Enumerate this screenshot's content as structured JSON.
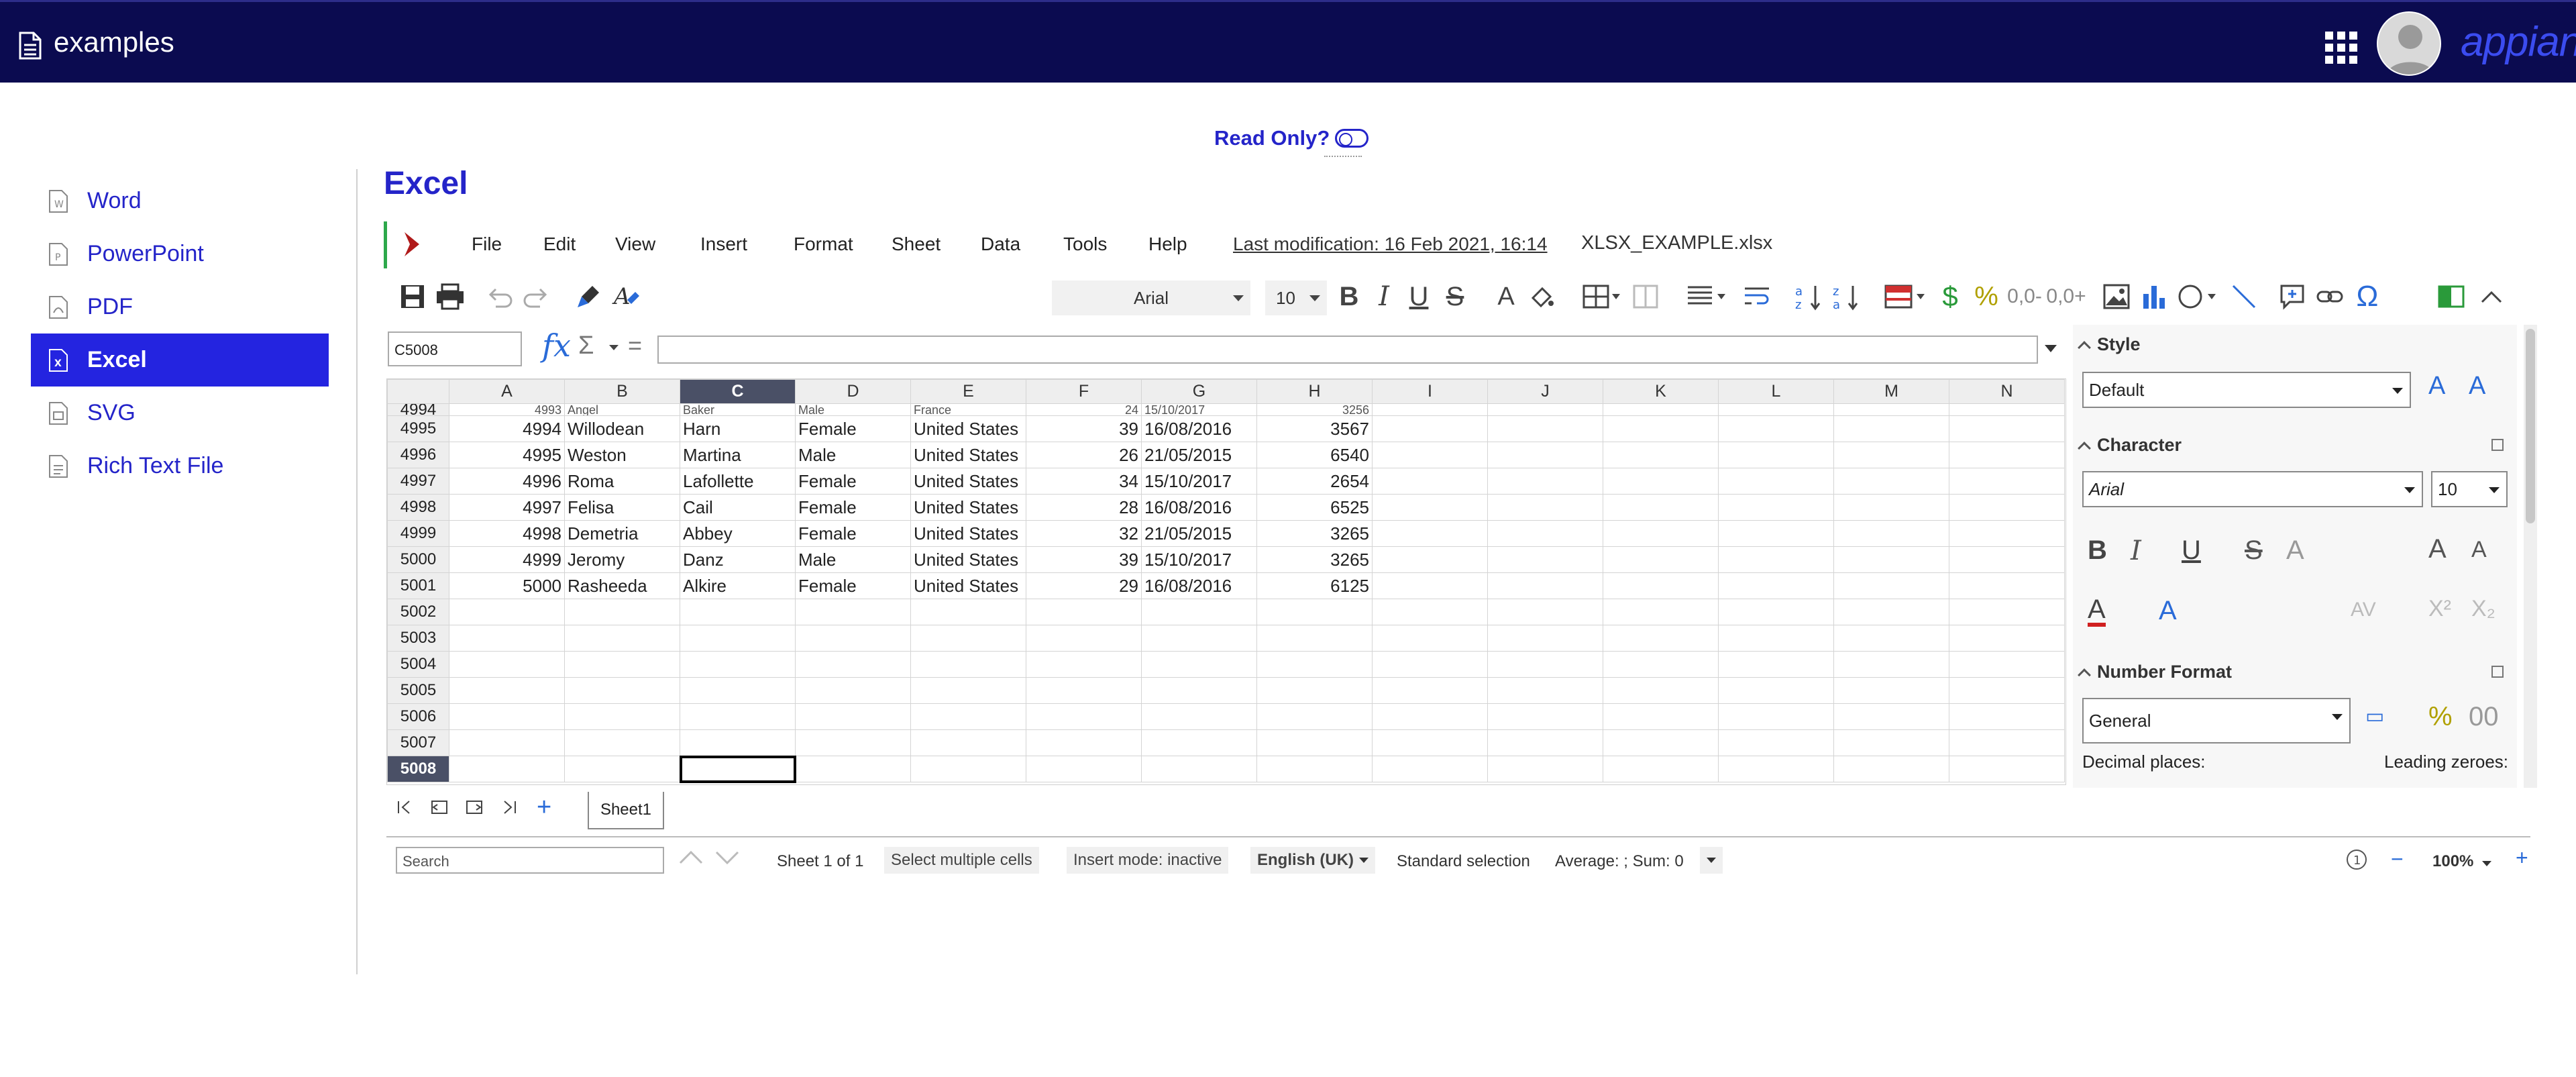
{
  "header": {
    "app_title": "examples",
    "logo_text": "appian"
  },
  "sidebar": {
    "items": [
      {
        "label": "Word",
        "icon": "word-file-icon"
      },
      {
        "label": "PowerPoint",
        "icon": "powerpoint-file-icon"
      },
      {
        "label": "PDF",
        "icon": "pdf-file-icon"
      },
      {
        "label": "Excel",
        "icon": "excel-file-icon",
        "active": true
      },
      {
        "label": "SVG",
        "icon": "svg-file-icon"
      },
      {
        "label": "Rich Text File",
        "icon": "rich-text-file-icon"
      }
    ]
  },
  "readonly": {
    "label": "Read Only?",
    "toggle_on": false
  },
  "page_title": "Excel",
  "menu": {
    "items": [
      "File",
      "Edit",
      "View",
      "Insert",
      "Format",
      "Sheet",
      "Data",
      "Tools",
      "Help"
    ],
    "last_modification": "Last modification:  16 Feb 2021, 16:14",
    "filename": "XLSX_EXAMPLE.xlsx"
  },
  "toolbar": {
    "font_name": "Arial",
    "font_size": "10"
  },
  "formula": {
    "cell_ref": "C5008",
    "fx_label": "fx",
    "sigma_label": "Σ",
    "equals_label": "=",
    "value": ""
  },
  "grid": {
    "columns": [
      "A",
      "B",
      "C",
      "D",
      "E",
      "F",
      "G",
      "H",
      "I",
      "J",
      "K",
      "L",
      "M",
      "N"
    ],
    "selected_column": "C",
    "partial_row": {
      "row": "4994",
      "cells": [
        "4993",
        "Angel",
        "Baker",
        "Male",
        "France",
        "24",
        "15/10/2017",
        "3256"
      ]
    },
    "rows": [
      {
        "row": "4995",
        "cells": [
          "4994",
          "Willodean",
          "Harn",
          "Female",
          "United States",
          "39",
          "16/08/2016",
          "3567"
        ]
      },
      {
        "row": "4996",
        "cells": [
          "4995",
          "Weston",
          "Martina",
          "Male",
          "United States",
          "26",
          "21/05/2015",
          "6540"
        ]
      },
      {
        "row": "4997",
        "cells": [
          "4996",
          "Roma",
          "Lafollette",
          "Female",
          "United States",
          "34",
          "15/10/2017",
          "2654"
        ]
      },
      {
        "row": "4998",
        "cells": [
          "4997",
          "Felisa",
          "Cail",
          "Female",
          "United States",
          "28",
          "16/08/2016",
          "6525"
        ]
      },
      {
        "row": "4999",
        "cells": [
          "4998",
          "Demetria",
          "Abbey",
          "Female",
          "United States",
          "32",
          "21/05/2015",
          "3265"
        ]
      },
      {
        "row": "5000",
        "cells": [
          "4999",
          "Jeromy",
          "Danz",
          "Male",
          "United States",
          "39",
          "15/10/2017",
          "3265"
        ]
      },
      {
        "row": "5001",
        "cells": [
          "5000",
          "Rasheeda",
          "Alkire",
          "Female",
          "United States",
          "29",
          "16/08/2016",
          "6125"
        ]
      },
      {
        "row": "5002",
        "cells": []
      },
      {
        "row": "5003",
        "cells": []
      },
      {
        "row": "5004",
        "cells": []
      },
      {
        "row": "5005",
        "cells": []
      },
      {
        "row": "5006",
        "cells": []
      },
      {
        "row": "5007",
        "cells": []
      },
      {
        "row": "5008",
        "cells": [],
        "selected": true
      }
    ]
  },
  "sheet_tabs": {
    "active": "Sheet1"
  },
  "status": {
    "search_placeholder": "Search",
    "sheet_count": "Sheet 1 of 1",
    "select_multiple": "Select multiple cells",
    "insert_mode": "Insert mode: inactive",
    "language": "English (UK)",
    "selection_mode": "Standard selection",
    "summary": "Average: ; Sum: 0",
    "zoom": "100%"
  },
  "deck": {
    "style_title": "Style",
    "style_value": "Default",
    "character_title": "Character",
    "font_value": "Arial",
    "size_value": "10",
    "number_format_title": "Number Format",
    "number_format_value": "General",
    "decimal_places_label": "Decimal places:",
    "leading_zeroes_label": "Leading zeroes:"
  },
  "colors": {
    "header_bg": "#0b0b50",
    "accent": "#2424e0",
    "selected_header": "#4a5066"
  }
}
